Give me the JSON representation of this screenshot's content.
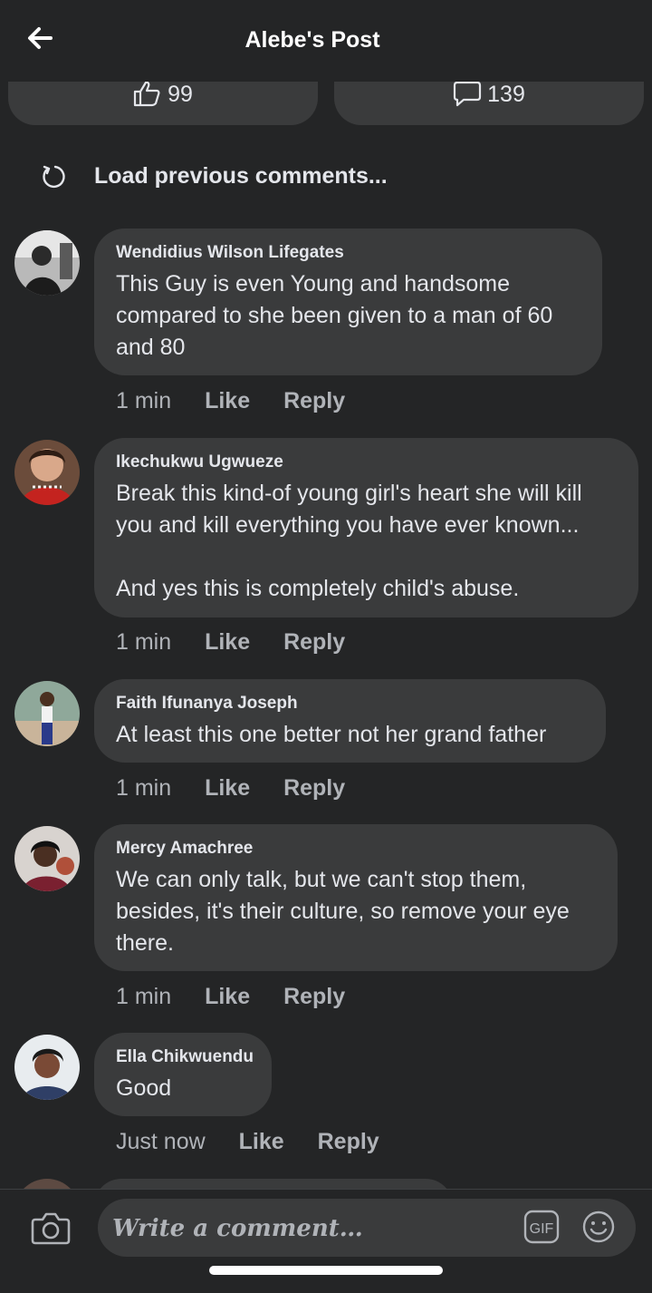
{
  "header": {
    "title": "Alebe's Post"
  },
  "stats": {
    "likes": "99",
    "comments": "139"
  },
  "load_previous": "Load previous comments...",
  "comments": [
    {
      "author": "Wendidius Wilson Lifegates",
      "text": "This Guy is even Young and handsome compared to she been given to a man of 60 and 80",
      "time": "1 min",
      "like": "Like",
      "reply": "Reply"
    },
    {
      "author": "Ikechukwu Ugwueze",
      "text": "Break this kind-of young girl's heart she will kill you and kill everything you have ever known...\n\nAnd yes this is completely child's abuse.",
      "time": "1 min",
      "like": "Like",
      "reply": "Reply"
    },
    {
      "author": "Faith Ifunanya Joseph",
      "text": "At least this one better not her grand father",
      "time": "1 min",
      "like": "Like",
      "reply": "Reply"
    },
    {
      "author": "Mercy Amachree",
      "text": "We can only talk, but we can't stop them, besides, it's their culture, so remove your eye there.",
      "time": "1 min",
      "like": "Like",
      "reply": "Reply"
    },
    {
      "author": "Ella Chikwuendu",
      "text": "Good",
      "time": "Just now",
      "like": "Like",
      "reply": "Reply"
    }
  ],
  "composer": {
    "placeholder": "Write a comment…"
  },
  "colors": {
    "background": "#242526",
    "bubble": "#3a3b3c",
    "text": "#e4e6eb",
    "muted": "#b0b3b8"
  },
  "icons": [
    "back-arrow-icon",
    "thumbs-up-icon",
    "comment-bubble-icon",
    "refresh-icon",
    "camera-icon",
    "gif-icon",
    "emoji-icon"
  ]
}
